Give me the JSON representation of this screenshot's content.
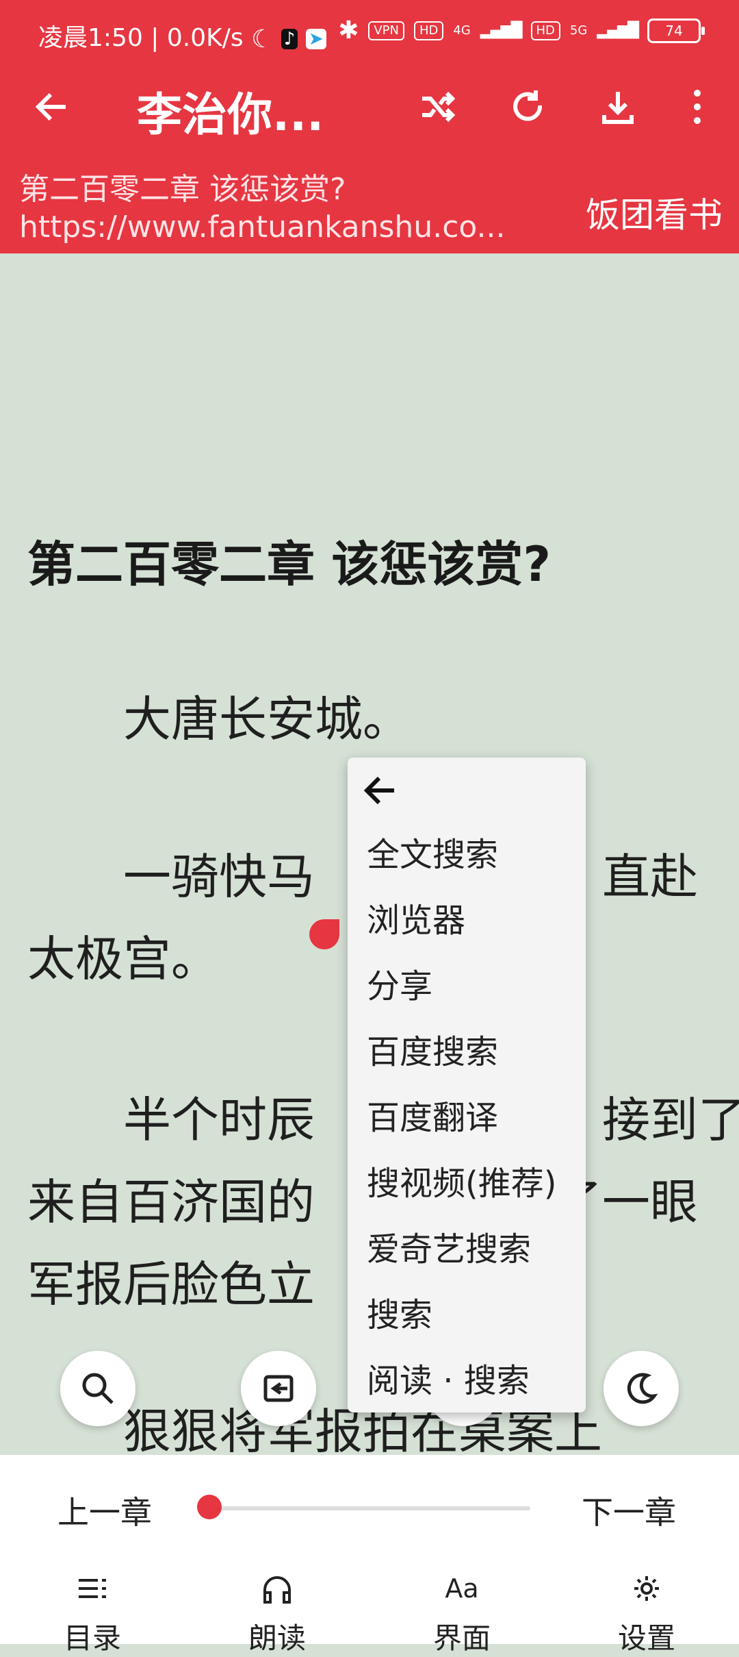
{
  "status_bar": {
    "time_info": "凌晨1:50 | 0.0K/s",
    "vpn": "VPN",
    "hd1": "HD",
    "net1": "4G",
    "hd2": "HD",
    "net2": "5G",
    "battery": "74"
  },
  "toolbar": {
    "title": "李治你...",
    "chapter_title": "第二百零二章 该惩该赏?",
    "url": "https://www.fantuankanshu.co...",
    "source": "饭团看书"
  },
  "content": {
    "chapter_heading": "第二百零二章 该惩该赏?",
    "paragraphs": [
      "　　大唐长安城。",
      "　　一骑快马　　　　　　直赴",
      "太极宫。",
      "　　半个时辰　　　　　　接到了",
      "来自百济国的　　　　　了一眼",
      "军报后脸色立",
      "　　狠狠将军报拍在桌案上"
    ]
  },
  "context_menu": {
    "items": [
      "全文搜索",
      "浏览器",
      "分享",
      "百度搜索",
      "百度翻译",
      "搜视频(推荐)",
      "爱奇艺搜索",
      "搜索",
      "阅读 · 搜索"
    ]
  },
  "bottom_bar": {
    "prev": "上一章",
    "next": "下一章",
    "progress": 0,
    "nav": [
      "目录",
      "朗读",
      "界面",
      "设置"
    ]
  }
}
